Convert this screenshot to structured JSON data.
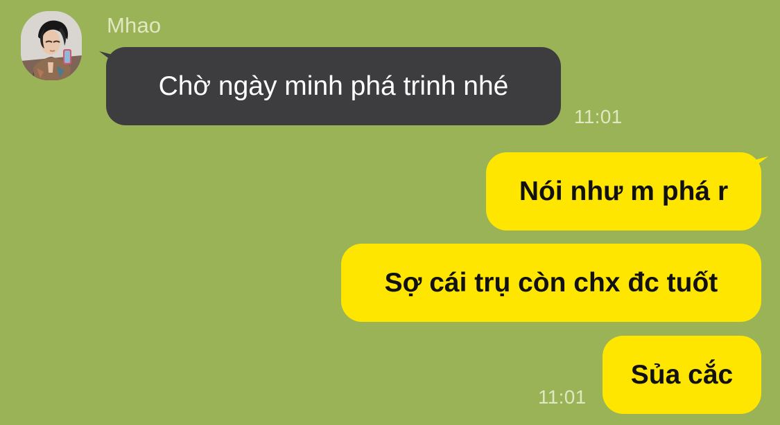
{
  "sender": {
    "name": "Mhao",
    "avatar_icon": "profile-photo-icon"
  },
  "messages": [
    {
      "side": "incoming",
      "text": "Chờ ngày minh phá trinh nhé",
      "time": "11:01"
    },
    {
      "side": "outgoing",
      "text": "Nói như m phá r"
    },
    {
      "side": "outgoing",
      "text": "Sợ cái trụ còn chx đc tuốt"
    },
    {
      "side": "outgoing",
      "text": "Sủa cắc",
      "time": "11:01"
    }
  ],
  "colors": {
    "background": "#9bb357",
    "incoming_bubble": "#3d3d3f",
    "outgoing_bubble": "#ffe600",
    "meta_text": "#dfe8c2"
  }
}
